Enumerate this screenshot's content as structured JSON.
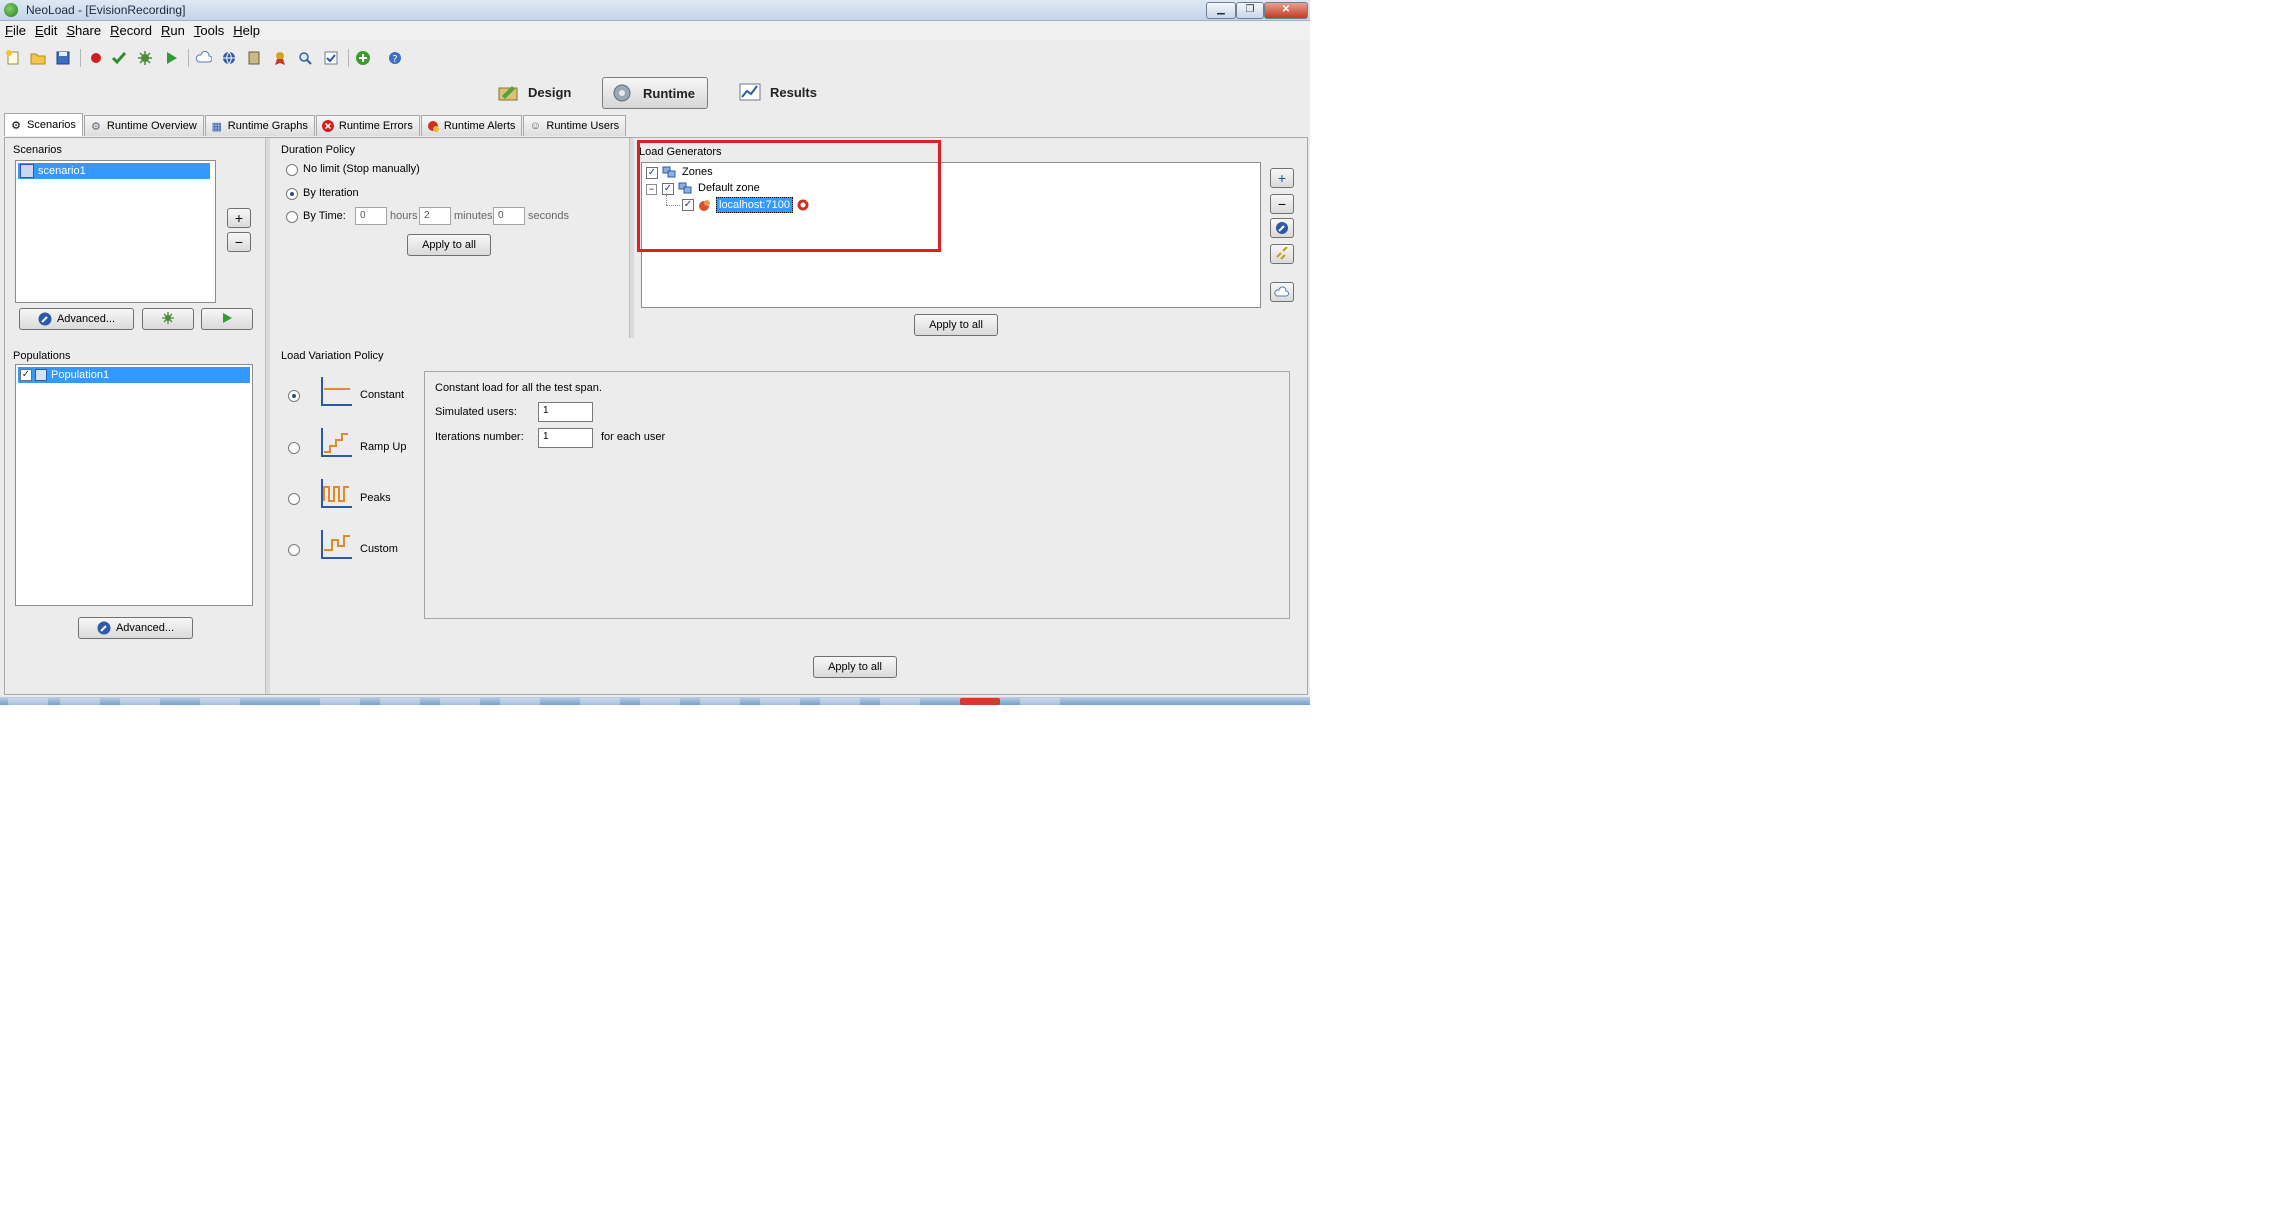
{
  "window": {
    "title": "NeoLoad - [EvisionRecording]",
    "minimize": "▁",
    "restore": "❐",
    "close": "✕"
  },
  "menu": [
    "File",
    "Edit",
    "Share",
    "Record",
    "Run",
    "Tools",
    "Help"
  ],
  "toolbar_icons": [
    "new-project-icon",
    "open-project-icon",
    "save-icon",
    "record-icon",
    "check-icon",
    "monitor-icon",
    "run-icon",
    "cloud-icon",
    "globe-icon",
    "book-icon",
    "badge-icon",
    "zoom-icon",
    "validate-icon",
    "update-icon",
    "help-icon"
  ],
  "perspectives": {
    "design": "Design",
    "runtime": "Runtime",
    "results": "Results"
  },
  "tabs": [
    "Scenarios",
    "Runtime Overview",
    "Runtime Graphs",
    "Runtime Errors",
    "Runtime Alerts",
    "Runtime Users"
  ],
  "scenarios": {
    "label": "Scenarios",
    "items": [
      "scenario1"
    ],
    "add": "+",
    "remove": "−",
    "advanced_label": "Advanced..."
  },
  "populations": {
    "label": "Populations",
    "items": [
      "Population1"
    ],
    "advanced_label": "Advanced..."
  },
  "duration_policy": {
    "label": "Duration Policy",
    "no_limit": "No limit (Stop manually)",
    "by_iteration": "By Iteration",
    "by_time": "By Time:",
    "hours_value": "0",
    "hours_unit": "hours",
    "minutes_value": "2",
    "minutes_unit": "minutes",
    "seconds_value": "0",
    "seconds_unit": "seconds",
    "selected": "by_iteration",
    "apply_label": "Apply to all"
  },
  "load_generators": {
    "label": "Load Generators",
    "tree": {
      "root": "Zones",
      "zone": "Default zone",
      "host": "localhost:7100",
      "expander": "−"
    },
    "apply_label": "Apply to all"
  },
  "load_variation": {
    "label": "Load Variation Policy",
    "options": [
      "Constant",
      "Ramp Up",
      "Peaks",
      "Custom"
    ],
    "selected": "Constant",
    "description": "Constant load for all the test span.",
    "simulated_users_label": "Simulated users:",
    "simulated_users": "1",
    "iterations_label": "Iterations number:",
    "iterations": "1",
    "for_each_user": "for each user",
    "apply_label": "Apply to all"
  },
  "highlight_color": "#e02020",
  "accent_color": "#3399ff"
}
